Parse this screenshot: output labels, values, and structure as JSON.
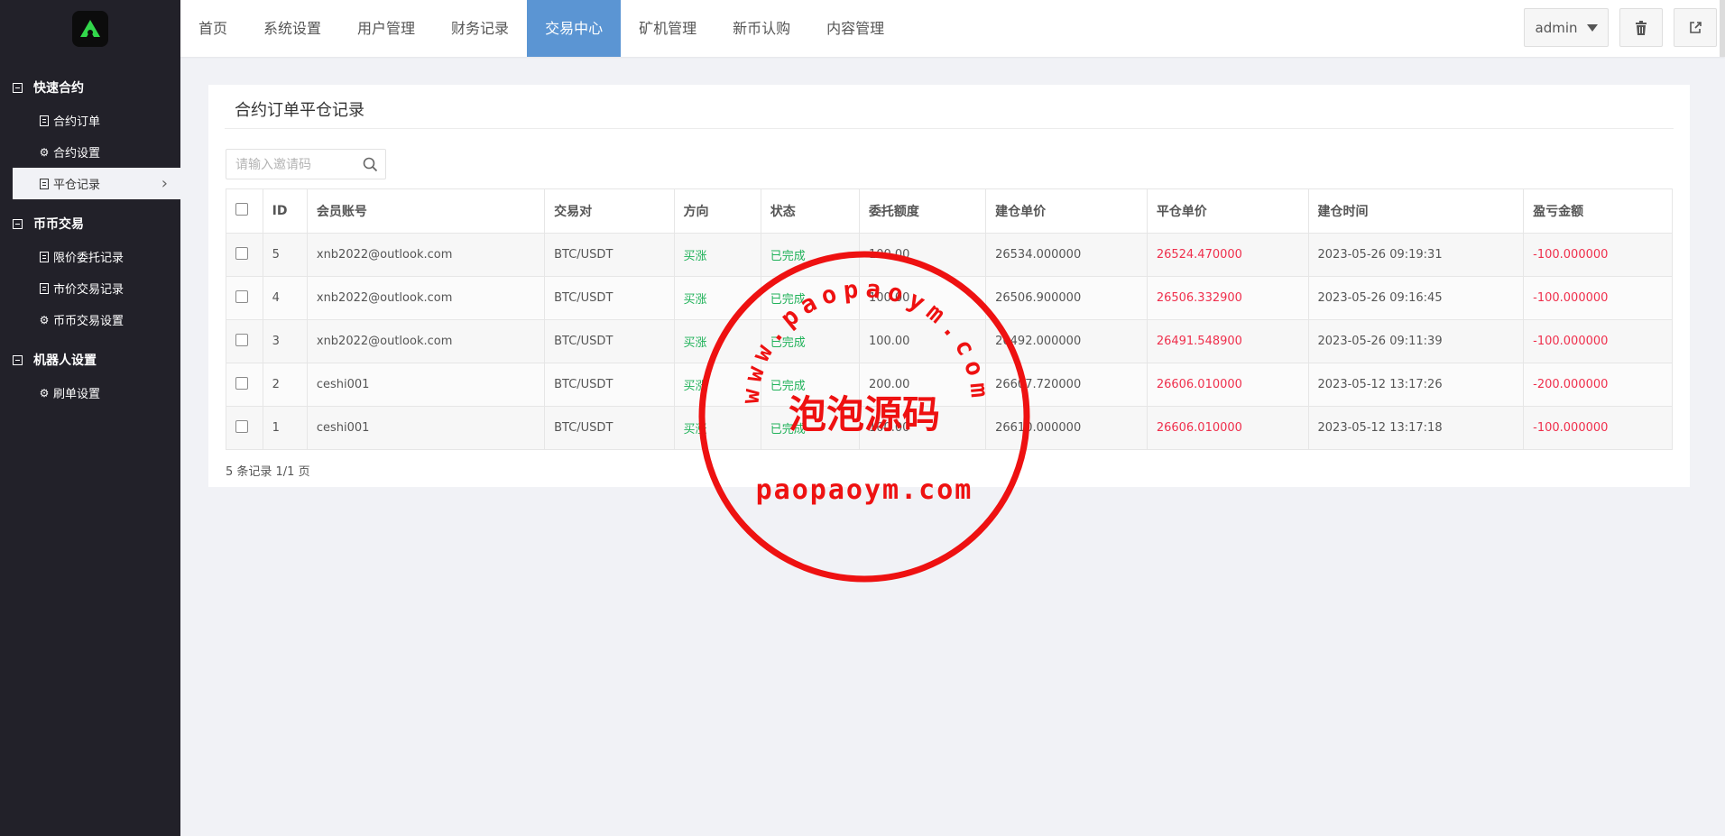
{
  "sidebar": {
    "groups": [
      {
        "title": "快速合约",
        "items": [
          {
            "label": "合约订单",
            "icon": "doc-icon"
          },
          {
            "label": "合约设置",
            "icon": "gear-icon"
          },
          {
            "label": "平仓记录",
            "icon": "doc-icon",
            "active": true
          }
        ]
      },
      {
        "title": "币币交易",
        "items": [
          {
            "label": "限价委托记录",
            "icon": "doc-icon"
          },
          {
            "label": "市价交易记录",
            "icon": "doc-icon"
          },
          {
            "label": "币币交易设置",
            "icon": "gear-icon"
          }
        ]
      },
      {
        "title": "机器人设置",
        "items": [
          {
            "label": "刷单设置",
            "icon": "gear-icon"
          }
        ]
      }
    ]
  },
  "topnav": {
    "items": [
      "首页",
      "系统设置",
      "用户管理",
      "财务记录",
      "交易中心",
      "矿机管理",
      "新币认购",
      "内容管理"
    ],
    "active_index": 4,
    "admin_label": "admin"
  },
  "page": {
    "title": "合约订单平仓记录",
    "search_placeholder": "请输入邀请码",
    "footer": "5 条记录 1/1 页"
  },
  "table": {
    "headers": [
      "ID",
      "会员账号",
      "交易对",
      "方向",
      "状态",
      "委托额度",
      "建仓单价",
      "平仓单价",
      "建仓时间",
      "盈亏金额"
    ],
    "rows": [
      [
        "5",
        "xnb2022@outlook.com",
        "BTC/USDT",
        "买涨",
        "已完成",
        "100.00",
        "26534.000000",
        "26524.470000",
        "2023-05-26 09:19:31",
        "-100.000000"
      ],
      [
        "4",
        "xnb2022@outlook.com",
        "BTC/USDT",
        "买涨",
        "已完成",
        "100.00",
        "26506.900000",
        "26506.332900",
        "2023-05-26 09:16:45",
        "-100.000000"
      ],
      [
        "3",
        "xnb2022@outlook.com",
        "BTC/USDT",
        "买涨",
        "已完成",
        "100.00",
        "26492.000000",
        "26491.548900",
        "2023-05-26 09:11:39",
        "-100.000000"
      ],
      [
        "2",
        "ceshi001",
        "BTC/USDT",
        "买涨",
        "已完成",
        "200.00",
        "26607.720000",
        "26606.010000",
        "2023-05-12 13:17:26",
        "-200.000000"
      ],
      [
        "1",
        "ceshi001",
        "BTC/USDT",
        "买涨",
        "已完成",
        "100.00",
        "26610.000000",
        "26606.010000",
        "2023-05-12 13:17:18",
        "-100.000000"
      ]
    ]
  },
  "watermark": {
    "arc_text": "www.paopaoym.com",
    "center_text": "泡泡源码",
    "bottom_text": "paopaoym.com",
    "color": "#ee1111"
  },
  "colors": {
    "sidebar_bg": "#222129",
    "nav_active": "#5b95d3",
    "positive": "#21b25a",
    "negative": "#ef2f4c"
  }
}
